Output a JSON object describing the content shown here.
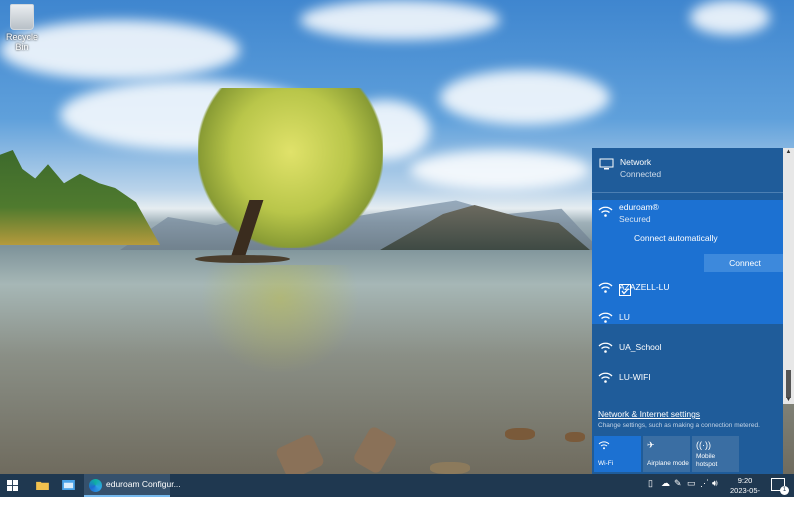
{
  "desktop": {
    "icons": [
      {
        "label": "Recycle Bin",
        "icon": "recycle-bin-icon"
      }
    ]
  },
  "network_flyout": {
    "header": {
      "title": "Network",
      "status": "Connected",
      "icon": "monitor-network-icon"
    },
    "selected_network": {
      "ssid": "eduroam®",
      "security": "Secured",
      "connect_automatically_label": "Connect automatically",
      "connect_automatically_checked": true,
      "connect_button_label": "Connect"
    },
    "networks": [
      {
        "ssid": "AZAZELL-LU"
      },
      {
        "ssid": "LU"
      },
      {
        "ssid": "UA_School"
      },
      {
        "ssid": "LU-WIFI"
      }
    ],
    "settings_link": "Network & Internet settings",
    "settings_description": "Change settings, such as making a connection metered.",
    "quick_actions": [
      {
        "label": "Wi-Fi",
        "icon": "wifi-icon",
        "active": true
      },
      {
        "label": "Airplane mode",
        "icon": "airplane-icon",
        "active": false
      },
      {
        "label": "Mobile hotspot",
        "icon": "hotspot-icon",
        "active": false
      }
    ]
  },
  "taskbar": {
    "active_app_label": "eduroam Configur...",
    "clock_time": "9:20",
    "clock_date": "2023-05-18",
    "notification_count": "1"
  },
  "colors": {
    "flyout_bg": "#1f5c9a",
    "selected_bg": "#1c71d2",
    "taskbar_bg": "#1f3850"
  }
}
